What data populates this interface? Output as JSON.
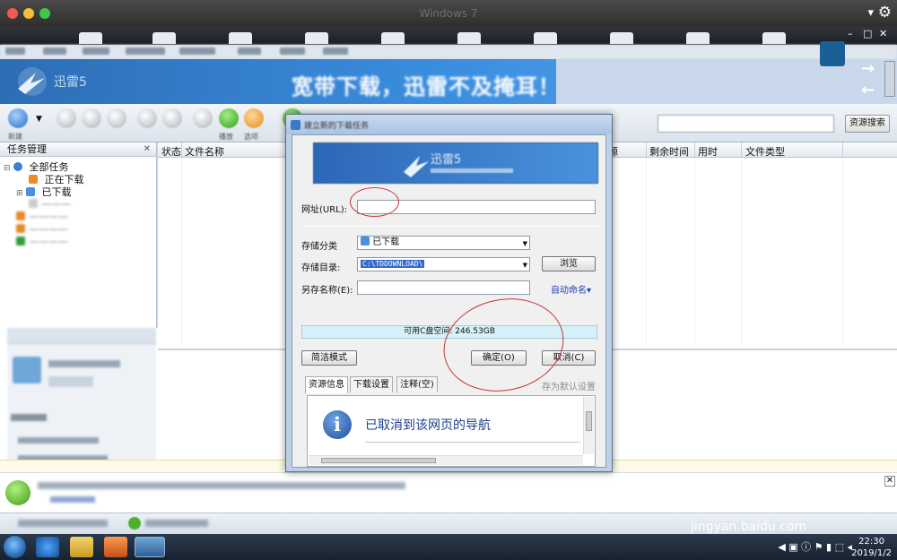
{
  "vm": {
    "title": "Windows 7",
    "menu_icon": "▾",
    "gear_icon": "⚙"
  },
  "banner": {
    "slogan": "宽带下载，迅雷不及掩耳！",
    "logo_text": "迅雷5"
  },
  "toolbar": {
    "search_button": "资源搜索"
  },
  "task_panel": {
    "title": "任务管理",
    "items": [
      {
        "label": "全部任务"
      },
      {
        "label": "正在下载"
      },
      {
        "label": "已下载"
      }
    ]
  },
  "task_list": {
    "columns": [
      "状态",
      "文件名称",
      "源",
      "剩余时间",
      "用时",
      "文件类型"
    ]
  },
  "dialog": {
    "url_label": "网址(URL):",
    "url_value": "",
    "category_label": "存储分类",
    "category_value": "已下载",
    "dir_label": "存储目录:",
    "dir_value": "C:\\TDDOWNLOAD\\",
    "browse_button": "浏览",
    "saveas_label": "另存名称(E):",
    "saveas_value": "",
    "auto_name_link": "自动命名▾",
    "free_space": "可用C盘空间: 246.53GB",
    "simple_mode_button": "简洁模式",
    "ok_button": "确定(O)",
    "cancel_button": "取消(C)",
    "tabs": [
      "资源信息",
      "下载设置",
      "注释(空)"
    ],
    "save_default_link": "存为默认设置",
    "info_message": "已取消到该网页的导航"
  },
  "taskbar": {
    "time": "22:30",
    "date": "2019/1/2"
  },
  "watermark": {
    "brand": "Baidu经验",
    "url": "jingyan.baidu.com"
  },
  "colors": {
    "annotation": "#c8333a",
    "link": "#1c3fb8",
    "banner": "#3a8ee0"
  }
}
